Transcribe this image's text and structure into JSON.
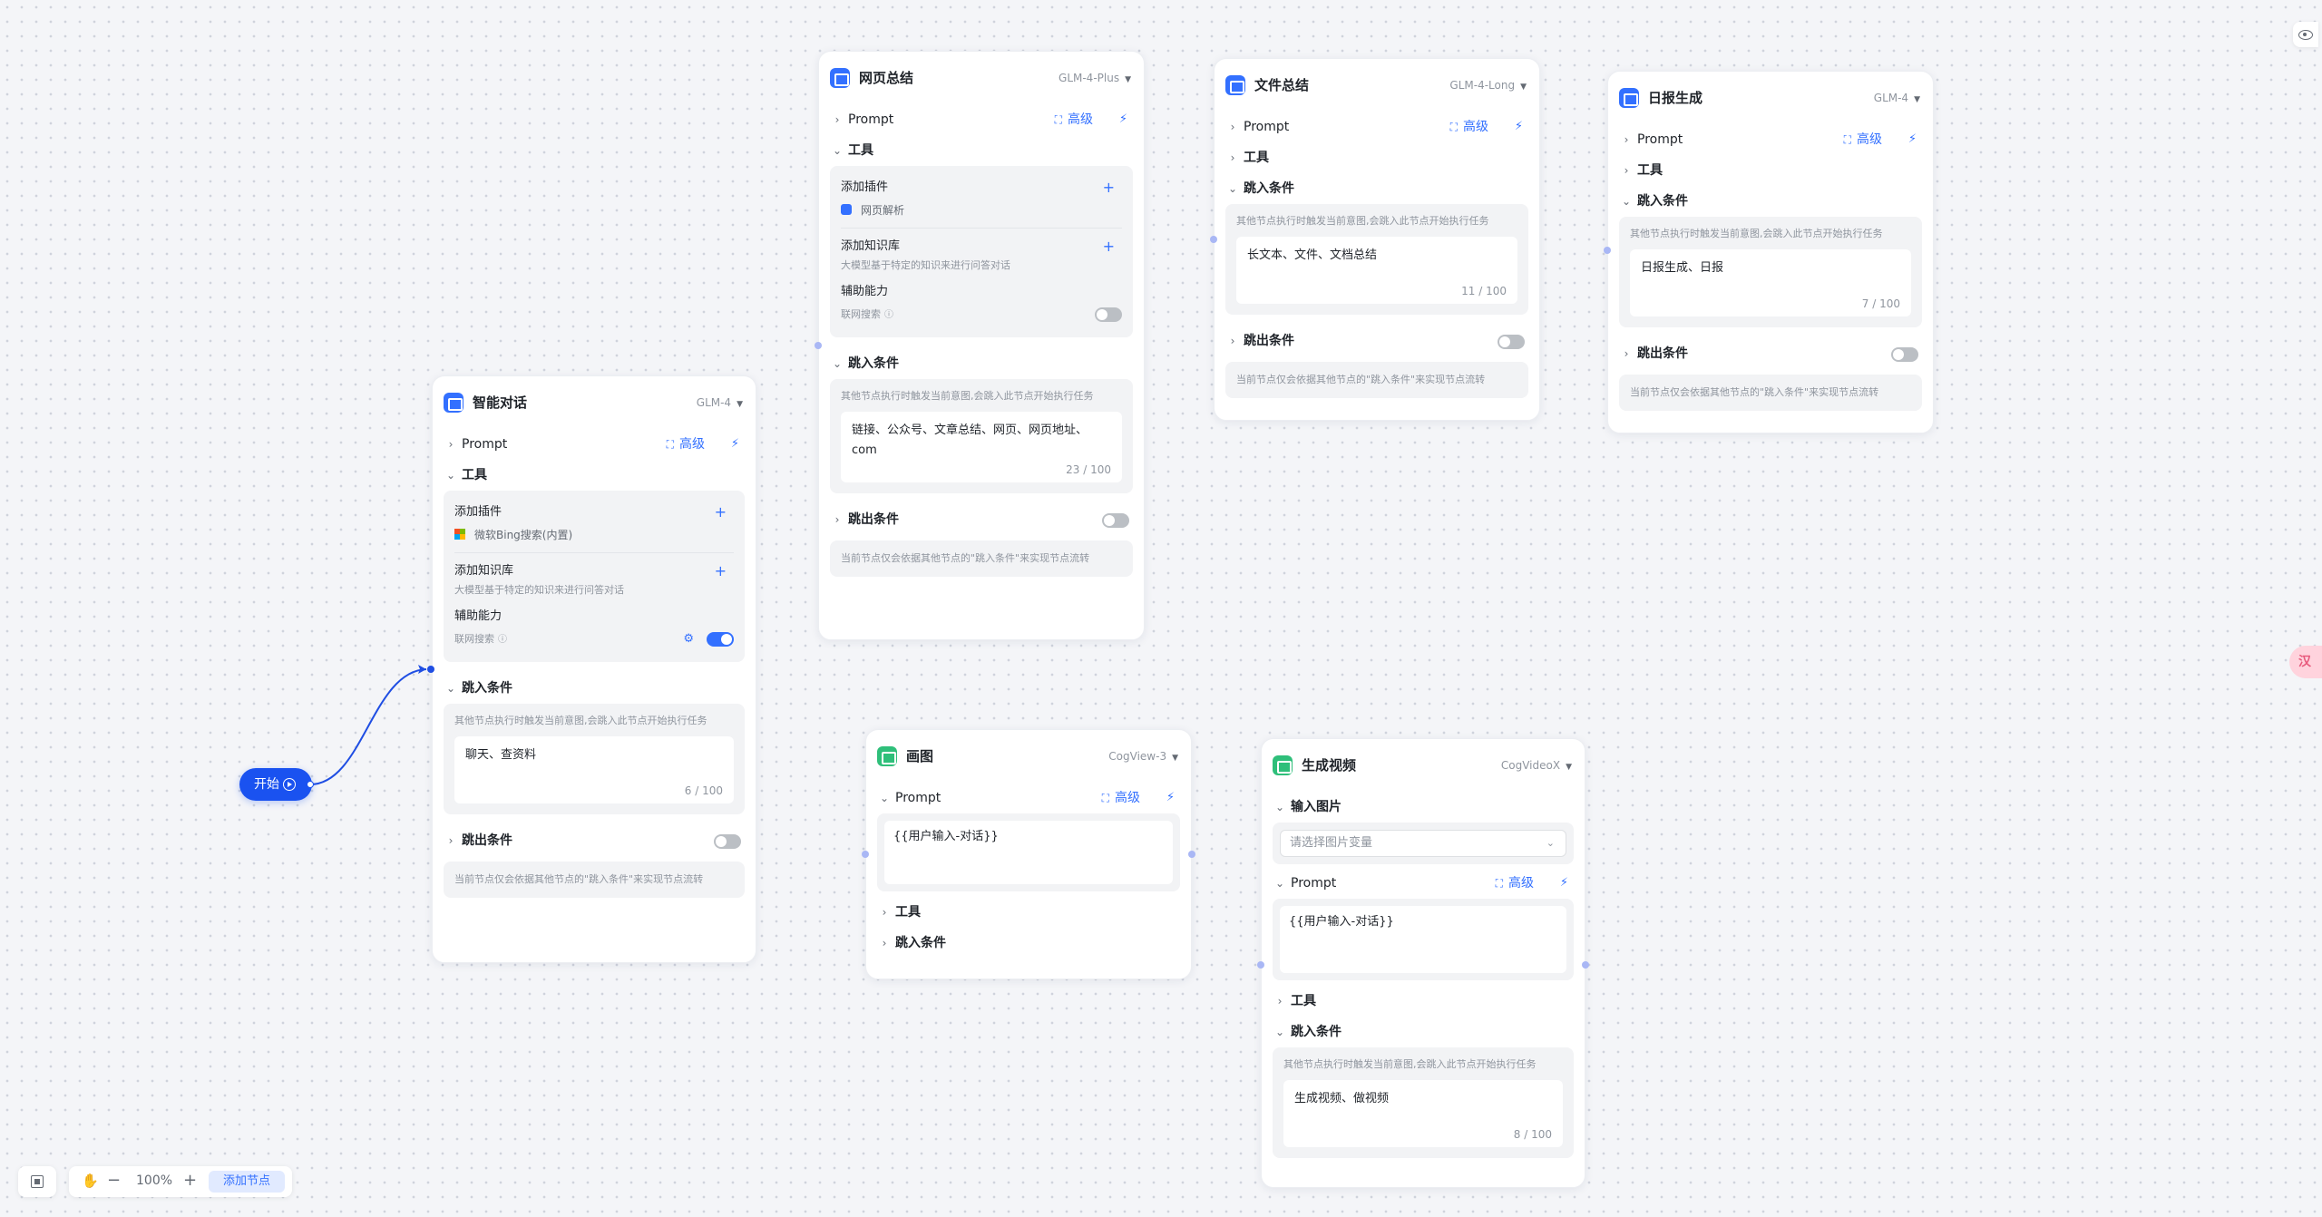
{
  "start": {
    "label": "开始"
  },
  "nodes": {
    "chat": {
      "title": "智能对话",
      "model": "GLM-4",
      "prompt_label": "Prompt",
      "advanced_label": "高级",
      "tools_label": "工具",
      "add_plugin_label": "添加插件",
      "plugin_name": "微软Bing搜索(内置)",
      "add_kb_label": "添加知识库",
      "kb_desc": "大模型基于特定的知识来进行问答对话",
      "assist_label": "辅助能力",
      "web_search_label": "联网搜索",
      "jump_in_label": "跳入条件",
      "jump_in_desc": "其他节点执行时触发当前意图,会跳入此节点开始执行任务",
      "jump_in_value": "聊天、查资料",
      "jump_in_count": "6 / 100",
      "jump_out_label": "跳出条件",
      "jump_out_desc": "当前节点仅会依据其他节点的\"跳入条件\"来实现节点流转"
    },
    "web": {
      "title": "网页总结",
      "model": "GLM-4-Plus",
      "prompt_label": "Prompt",
      "advanced_label": "高级",
      "tools_label": "工具",
      "add_plugin_label": "添加插件",
      "plugin_name": "网页解析",
      "add_kb_label": "添加知识库",
      "kb_desc": "大模型基于特定的知识来进行问答对话",
      "assist_label": "辅助能力",
      "web_search_label": "联网搜索",
      "jump_in_label": "跳入条件",
      "jump_in_desc": "其他节点执行时触发当前意图,会跳入此节点开始执行任务",
      "jump_in_value_line1": "链接、公众号、文章总结、网页、网页地址、",
      "jump_in_value_line2": "com",
      "jump_in_count": "23 / 100",
      "jump_out_label": "跳出条件",
      "jump_out_desc": "当前节点仅会依据其他节点的\"跳入条件\"来实现节点流转"
    },
    "file": {
      "title": "文件总结",
      "model": "GLM-4-Long",
      "prompt_label": "Prompt",
      "advanced_label": "高级",
      "tools_label": "工具",
      "jump_in_label": "跳入条件",
      "jump_in_desc": "其他节点执行时触发当前意图,会跳入此节点开始执行任务",
      "jump_in_value": "长文本、文件、文档总结",
      "jump_in_count": "11 / 100",
      "jump_out_label": "跳出条件",
      "jump_out_desc": "当前节点仅会依据其他节点的\"跳入条件\"来实现节点流转"
    },
    "daily": {
      "title": "日报生成",
      "model": "GLM-4",
      "prompt_label": "Prompt",
      "advanced_label": "高级",
      "tools_label": "工具",
      "jump_in_label": "跳入条件",
      "jump_in_desc": "其他节点执行时触发当前意图,会跳入此节点开始执行任务",
      "jump_in_value": "日报生成、日报",
      "jump_in_count": "7 / 100",
      "jump_out_label": "跳出条件",
      "jump_out_desc": "当前节点仅会依据其他节点的\"跳入条件\"来实现节点流转"
    },
    "draw": {
      "title": "画图",
      "model": "CogView-3",
      "prompt_label": "Prompt",
      "advanced_label": "高级",
      "prompt_value": "{{用户输入-对话}}",
      "tools_label": "工具",
      "jump_in_label": "跳入条件"
    },
    "video": {
      "title": "生成视频",
      "model": "CogVideoX",
      "input_image_label": "输入图片",
      "image_placeholder": "请选择图片变量",
      "prompt_label": "Prompt",
      "advanced_label": "高级",
      "prompt_value": "{{用户输入-对话}}",
      "tools_label": "工具",
      "jump_in_label": "跳入条件",
      "jump_in_desc": "其他节点执行时触发当前意图,会跳入此节点开始执行任务",
      "jump_in_value": "生成视频、做视频",
      "jump_in_count": "8 / 100"
    }
  },
  "toolbar": {
    "zoom": "100%",
    "add_node_label": "添加节点"
  },
  "side_float": {
    "label": "汉"
  },
  "colors": {
    "accent": "#3370ff",
    "start": "#1a52f0",
    "edge": "#1f4ee3"
  }
}
